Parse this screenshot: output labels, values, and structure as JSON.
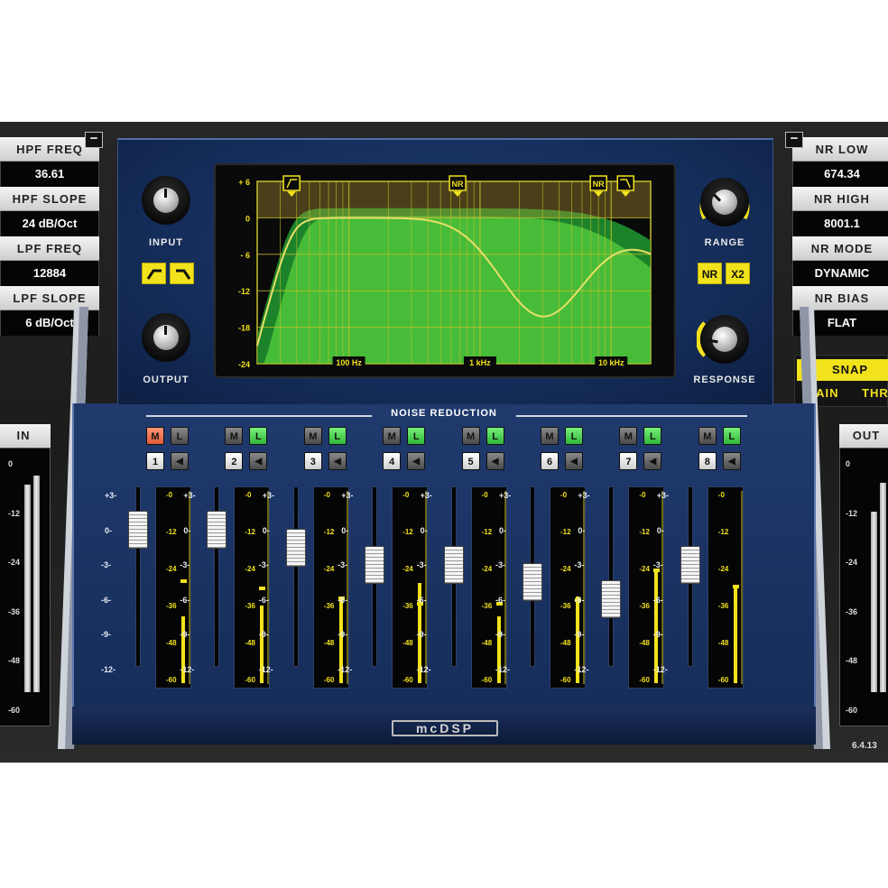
{
  "left_params": [
    {
      "label": "HPF FREQ",
      "value": "36.61"
    },
    {
      "label": "HPF SLOPE",
      "value": "24 dB/Oct"
    },
    {
      "label": "LPF FREQ",
      "value": "12884"
    },
    {
      "label": "LPF SLOPE",
      "value": "6 dB/Oct"
    }
  ],
  "right_params": [
    {
      "label": "NR LOW",
      "value": "674.34"
    },
    {
      "label": "NR HIGH",
      "value": "8001.1"
    },
    {
      "label": "NR MODE",
      "value": "DYNAMIC"
    },
    {
      "label": "NR BIAS",
      "value": "FLAT"
    }
  ],
  "collapse_symbol": "−",
  "snap": {
    "button": "SNAP",
    "gain": "GAIN",
    "thr": "THR"
  },
  "in_meter": {
    "title": "IN",
    "ticks": [
      "0",
      "-12",
      "-24",
      "-36",
      "-48",
      "-60"
    ],
    "level_left": 0.92,
    "level_right": 0.96
  },
  "out_meter": {
    "title": "OUT",
    "ticks": [
      "0",
      "-12",
      "-24",
      "-36",
      "-48",
      "-60"
    ],
    "level_left": 0.8,
    "level_right": 0.93
  },
  "version": "6.4.13",
  "knobs": {
    "input": "INPUT",
    "output": "OUTPUT",
    "range": "RANGE",
    "response": "RESPONSE"
  },
  "filter_buttons": {
    "hpf_icon": "highpass-icon",
    "lpf_icon": "lowpass-icon"
  },
  "nr_buttons": {
    "nr": "NR",
    "x2": "X2"
  },
  "eq_display": {
    "y_ticks": [
      "+ 6",
      "0",
      "- 6",
      "-12",
      "-18",
      "-24"
    ],
    "x_ticks": [
      "100 Hz",
      "1 kHz",
      "10 kHz"
    ],
    "markers": [
      {
        "label": "",
        "icon": "hpf-marker-icon",
        "freq": 36.61
      },
      {
        "label": "NR",
        "icon": "",
        "freq": 674.34
      },
      {
        "label": "NR",
        "icon": "",
        "freq": 8001.1
      },
      {
        "label": "",
        "icon": "lpf-marker-icon",
        "freq": 12884
      }
    ],
    "colors": {
      "grid": "#c8c12a",
      "curve": "#e8e06a",
      "fill": "#4cc23a",
      "fill_dark": "#1f8a2c"
    }
  },
  "noise_reduction_title": "NOISE REDUCTION",
  "gain_ticks": [
    "+3-",
    "0-",
    "-3-",
    "-6-",
    "-9-",
    "-12-"
  ],
  "meter_ticks": [
    "-0",
    "-12",
    "-24",
    "-36",
    "-48",
    "-60"
  ],
  "channels": [
    {
      "number": "1",
      "m": "M",
      "l": "L",
      "mute_on": true,
      "listen_on": false,
      "gain_db": 0.0,
      "level": 0.36,
      "peak": 0.56
    },
    {
      "number": "2",
      "m": "M",
      "l": "L",
      "mute_on": false,
      "listen_on": true,
      "gain_db": 0.0,
      "level": 0.42,
      "peak": 0.52
    },
    {
      "number": "3",
      "m": "M",
      "l": "L",
      "mute_on": false,
      "listen_on": true,
      "gain_db": -1.5,
      "level": 0.47,
      "peak": 0.47
    },
    {
      "number": "4",
      "m": "M",
      "l": "L",
      "mute_on": false,
      "listen_on": true,
      "gain_db": -3.0,
      "level": 0.54,
      "peak": 0.44
    },
    {
      "number": "5",
      "m": "M",
      "l": "L",
      "mute_on": false,
      "listen_on": true,
      "gain_db": -3.0,
      "level": 0.36,
      "peak": 0.44
    },
    {
      "number": "6",
      "m": "M",
      "l": "L",
      "mute_on": false,
      "listen_on": true,
      "gain_db": -4.5,
      "level": 0.47,
      "peak": 0.46
    },
    {
      "number": "7",
      "m": "M",
      "l": "L",
      "mute_on": false,
      "listen_on": true,
      "gain_db": -6.0,
      "level": 0.62,
      "peak": 0.62
    },
    {
      "number": "8",
      "m": "M",
      "l": "L",
      "mute_on": false,
      "listen_on": true,
      "gain_db": -3.0,
      "level": 0.53,
      "peak": 0.53
    }
  ],
  "speaker_glyph": "◀",
  "logo": "mcDSP"
}
